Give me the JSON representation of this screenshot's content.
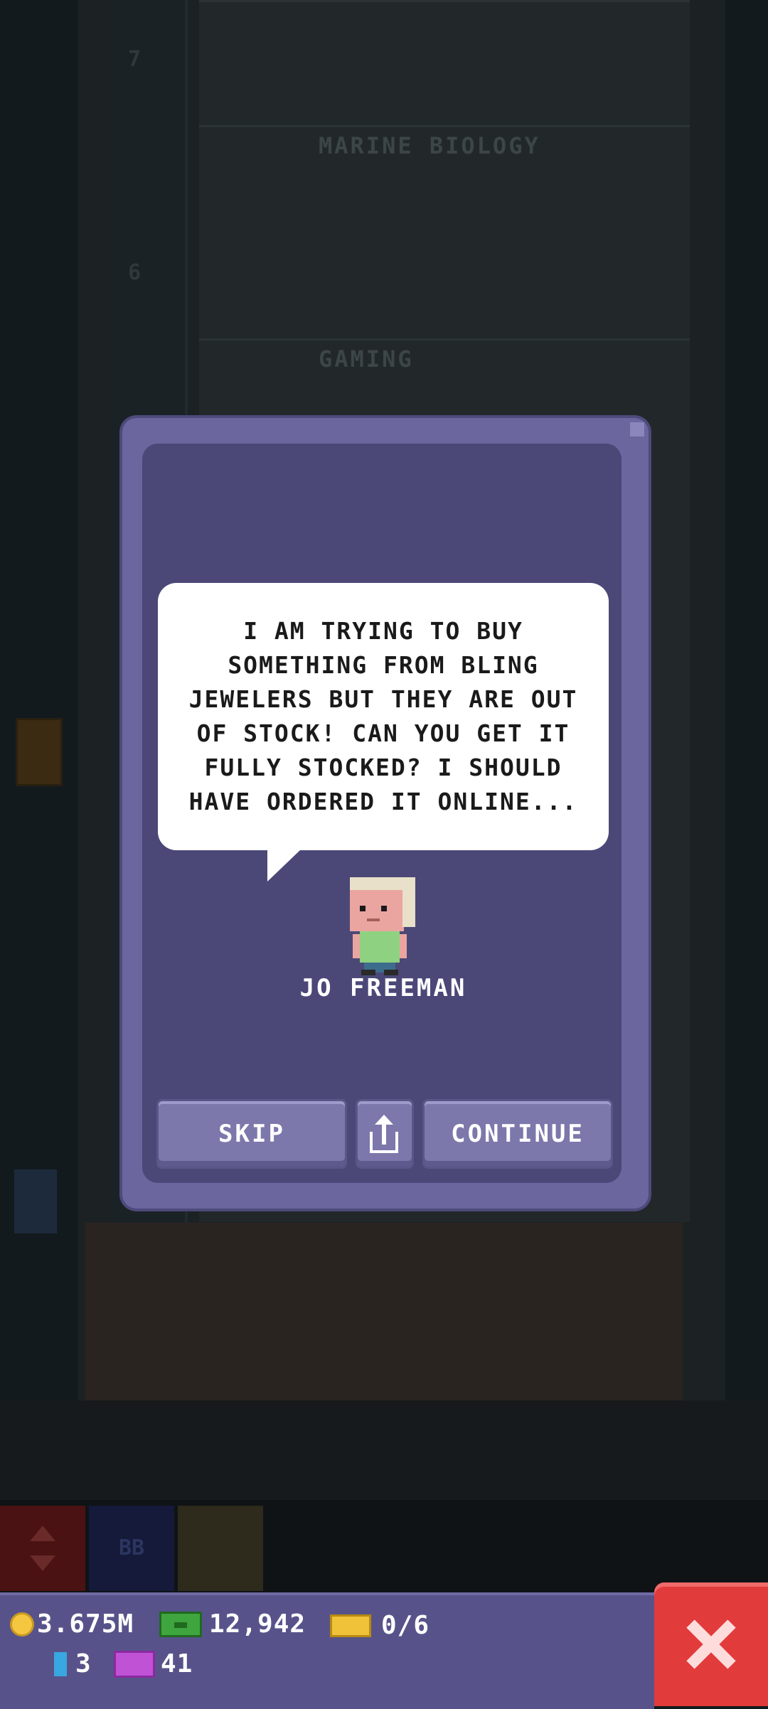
{
  "background": {
    "floors": [
      {
        "label": "MARINE BIOLOGY",
        "number": "7"
      },
      {
        "label": "GAMING",
        "number": "6"
      }
    ],
    "mini_buttons": {
      "bb_label": "BB"
    }
  },
  "dialog": {
    "message": "I AM TRYING TO BUY SOMETHING FROM BLING JEWELERS BUT THEY ARE OUT OF STOCK! CAN YOU GET IT FULLY STOCKED? I SHOULD HAVE ORDERED IT ONLINE...",
    "character_name": "JO FREEMAN",
    "skip_label": "SKIP",
    "continue_label": "CONTINUE",
    "share_icon": "share-icon"
  },
  "hud": {
    "coins": "3.675M",
    "tower_bux": "12,942",
    "tickets": "0/6",
    "blueprints": "3",
    "vip": "41",
    "close_icon": "close-icon"
  }
}
